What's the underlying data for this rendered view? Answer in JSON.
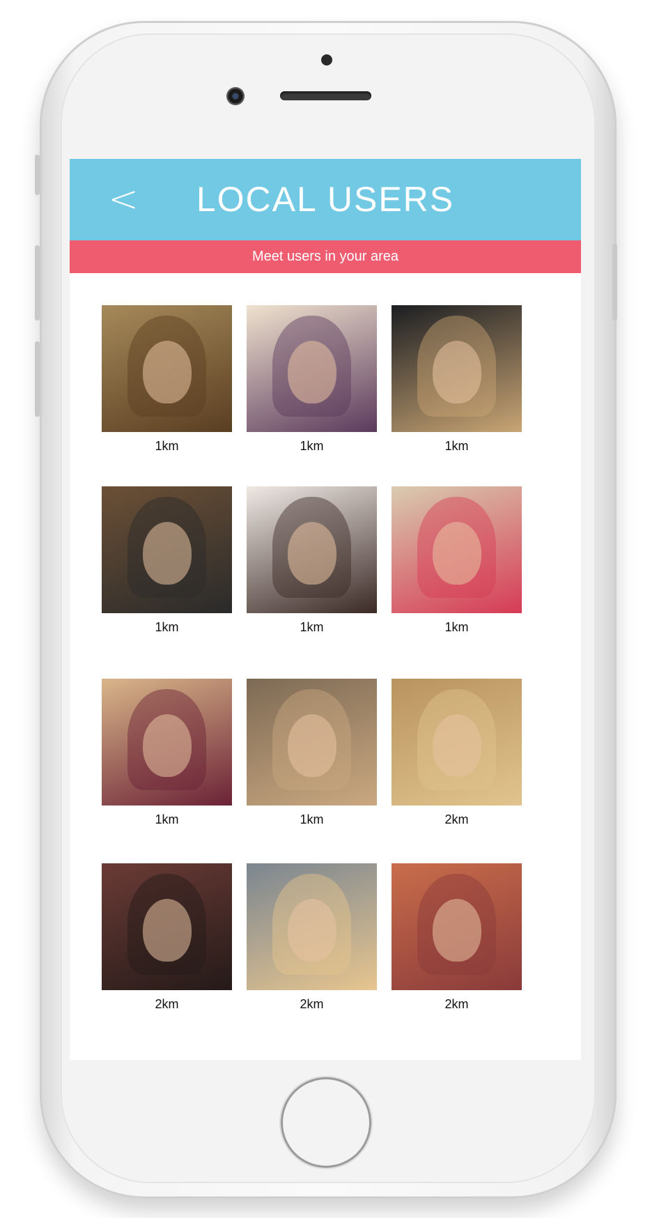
{
  "header": {
    "back_icon": "chevron-left-icon",
    "back_glyph": "<",
    "title": "LOCAL USERS"
  },
  "subheader": {
    "text": "Meet users in your area"
  },
  "colors": {
    "header_bg": "#72c9e3",
    "subheader_bg": "#ef5c70"
  },
  "users": [
    {
      "distance": "1km",
      "photo_tone": [
        "#a58a5a",
        "#5a3e22"
      ]
    },
    {
      "distance": "1km",
      "photo_tone": [
        "#efe2cf",
        "#5b3a5c"
      ]
    },
    {
      "distance": "1km",
      "photo_tone": [
        "#1c1e22",
        "#c9a574"
      ]
    },
    {
      "distance": "1km",
      "photo_tone": [
        "#6c5036",
        "#2a2a2a"
      ]
    },
    {
      "distance": "1km",
      "photo_tone": [
        "#efe9e4",
        "#3b2a26"
      ]
    },
    {
      "distance": "1km",
      "photo_tone": [
        "#d9cbb0",
        "#d63b55"
      ]
    },
    {
      "distance": "1km",
      "photo_tone": [
        "#d9b68a",
        "#6b2236"
      ]
    },
    {
      "distance": "1km",
      "photo_tone": [
        "#7d6a55",
        "#caa880"
      ]
    },
    {
      "distance": "2km",
      "photo_tone": [
        "#b9935f",
        "#e1c48d"
      ]
    },
    {
      "distance": "2km",
      "photo_tone": [
        "#6b3b36",
        "#241a18"
      ]
    },
    {
      "distance": "2km",
      "photo_tone": [
        "#7b8690",
        "#e7c58f"
      ]
    },
    {
      "distance": "2km",
      "photo_tone": [
        "#c96d4b",
        "#8a3a3a"
      ]
    }
  ]
}
